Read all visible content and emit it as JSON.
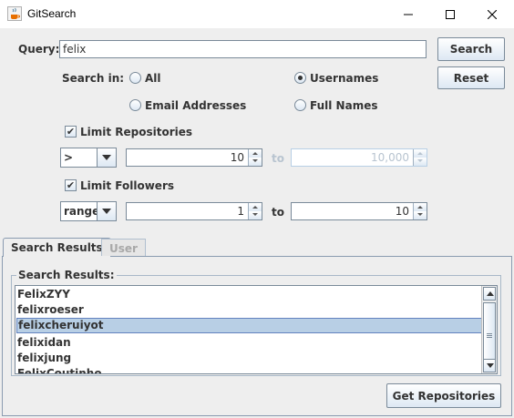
{
  "window": {
    "title": "GitSearch",
    "icon": "java-cup-icon"
  },
  "query": {
    "label": "Query:",
    "value": "felix",
    "search_button": "Search",
    "reset_button": "Reset"
  },
  "search_in": {
    "label": "Search in:",
    "options": [
      {
        "label": "All",
        "selected": false
      },
      {
        "label": "Usernames",
        "selected": true
      },
      {
        "label": "Email Addresses",
        "selected": false
      },
      {
        "label": "Full Names",
        "selected": false
      }
    ]
  },
  "limit_repos": {
    "label": "Limit Repositories",
    "checked": true,
    "operator": ">",
    "from": "10",
    "to_label": "to",
    "to": "10,000",
    "to_enabled": false
  },
  "limit_followers": {
    "label": "Limit Followers",
    "checked": true,
    "operator": "range",
    "from": "1",
    "to_label": "to",
    "to": "10"
  },
  "tabs": [
    {
      "label": "Search Results",
      "active": true
    },
    {
      "label": "User",
      "active": false
    }
  ],
  "results": {
    "title": "Search Results:",
    "items": [
      "FelixZYY",
      "felixroeser",
      "felixcheruiyot",
      "felixidan",
      "felixjung",
      "FelixCoutinho"
    ],
    "selected_index": 2,
    "get_repos_button": "Get Repositories"
  },
  "colors": {
    "selection": "#b8cfe5",
    "selection_border": "#6382bf",
    "border": "#7a8a99",
    "window_bg": "#eeeeee"
  }
}
